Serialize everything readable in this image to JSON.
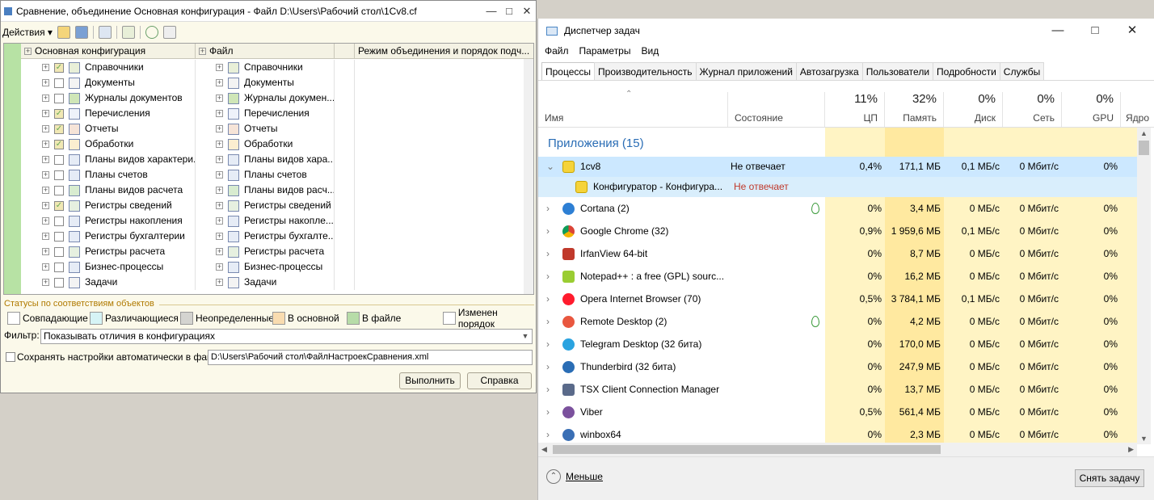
{
  "win1c": {
    "title": "Сравнение, объединение Основная конфигурация - Файл D:\\Users\\Рабочий стол\\1Cv8.cf",
    "actions": "Действия",
    "columns": [
      "Основная конфигурация",
      "Файл",
      "",
      "Режим объединения и порядок подч..."
    ],
    "rows": [
      {
        "left": "Справочники",
        "right": "Справочники",
        "checked": true
      },
      {
        "left": "Документы",
        "right": "Документы",
        "checked": false
      },
      {
        "left": "Журналы документов",
        "right": "Журналы докумен...",
        "checked": false
      },
      {
        "left": "Перечисления",
        "right": "Перечисления",
        "checked": true
      },
      {
        "left": "Отчеты",
        "right": "Отчеты",
        "checked": true
      },
      {
        "left": "Обработки",
        "right": "Обработки",
        "checked": true
      },
      {
        "left": "Планы видов характери...",
        "right": "Планы видов хара...",
        "checked": false
      },
      {
        "left": "Планы счетов",
        "right": "Планы счетов",
        "checked": false
      },
      {
        "left": "Планы видов расчета",
        "right": "Планы видов расч...",
        "checked": false
      },
      {
        "left": "Регистры сведений",
        "right": "Регистры сведений",
        "checked": true
      },
      {
        "left": "Регистры накопления",
        "right": "Регистры накопле...",
        "checked": false
      },
      {
        "left": "Регистры бухгалтерии",
        "right": "Регистры бухгалте...",
        "checked": false
      },
      {
        "left": "Регистры расчета",
        "right": "Регистры расчета",
        "checked": false
      },
      {
        "left": "Бизнес-процессы",
        "right": "Бизнес-процессы",
        "checked": false
      },
      {
        "left": "Задачи",
        "right": "Задачи",
        "checked": false
      }
    ],
    "legend_title": "Статусы по соответствиям объектов",
    "legend": [
      {
        "label": "Совпадающие",
        "color": "#ffffff"
      },
      {
        "label": "Различающиеся",
        "color": "#d6f4f6"
      },
      {
        "label": "Неопределенные",
        "color": "#d4d4d0"
      },
      {
        "label": "В основной",
        "color": "#f9dcb0"
      },
      {
        "label": "В файле",
        "color": "#b7dca8"
      },
      {
        "label": "Изменен порядок",
        "color": "#ffffff"
      }
    ],
    "filter_label": "Фильтр:",
    "filter_value": "Показывать отличия в конфигурациях",
    "save_label": "Сохранять настройки автоматически в файл:",
    "save_path": "D:\\Users\\Рабочий стол\\ФайлНастроекСравнения.xml",
    "btn_run": "Выполнить",
    "btn_help": "Справка"
  },
  "tm": {
    "title": "Диспетчер задач",
    "menu": [
      "Файл",
      "Параметры",
      "Вид"
    ],
    "tabs": [
      "Процессы",
      "Производительность",
      "Журнал приложений",
      "Автозагрузка",
      "Пользователи",
      "Подробности",
      "Службы"
    ],
    "headers": {
      "name": "Имя",
      "status": "Состояние",
      "cpu_pct": "11%",
      "cpu": "ЦП",
      "mem_pct": "32%",
      "mem": "Память",
      "disk_pct": "0%",
      "disk": "Диск",
      "net_pct": "0%",
      "net": "Сеть",
      "gpu_pct": "0%",
      "gpu": "GPU",
      "gpu_engine": "Ядро "
    },
    "group": "Приложения (15)",
    "processes": [
      {
        "name": "1cv8",
        "status": "Не отвечает",
        "cpu": "0,4%",
        "mem": "171,1 МБ",
        "disk": "0,1 МБ/с",
        "net": "0 Мбит/с",
        "gpu": "0%",
        "icon": "1c-icon",
        "expanded": true
      },
      {
        "name": "Конфигуратор - Конфигура...",
        "status": "Не отвечает",
        "child": true,
        "icon": "1c-icon"
      },
      {
        "name": "Cortana (2)",
        "status": "",
        "cpu": "0%",
        "mem": "3,4 МБ",
        "disk": "0 МБ/с",
        "net": "0 Мбит/с",
        "gpu": "0%",
        "icon": "cortana-icon",
        "leaf": true
      },
      {
        "name": "Google Chrome (32)",
        "status": "",
        "cpu": "0,9%",
        "mem": "1 959,6 МБ",
        "disk": "0,1 МБ/с",
        "net": "0 Мбит/с",
        "gpu": "0%",
        "icon": "chrome-icon"
      },
      {
        "name": "IrfanView 64-bit",
        "status": "",
        "cpu": "0%",
        "mem": "8,7 МБ",
        "disk": "0 МБ/с",
        "net": "0 Мбит/с",
        "gpu": "0%",
        "icon": "irfanview-icon"
      },
      {
        "name": "Notepad++ : a free (GPL) sourc...",
        "status": "",
        "cpu": "0%",
        "mem": "16,2 МБ",
        "disk": "0 МБ/с",
        "net": "0 Мбит/с",
        "gpu": "0%",
        "icon": "notepadpp-icon"
      },
      {
        "name": "Opera Internet Browser (70)",
        "status": "",
        "cpu": "0,5%",
        "mem": "3 784,1 МБ",
        "disk": "0,1 МБ/с",
        "net": "0 Мбит/с",
        "gpu": "0%",
        "icon": "opera-icon"
      },
      {
        "name": "Remote Desktop (2)",
        "status": "",
        "cpu": "0%",
        "mem": "4,2 МБ",
        "disk": "0 МБ/с",
        "net": "0 Мбит/с",
        "gpu": "0%",
        "icon": "remote-desktop-icon",
        "leaf": true
      },
      {
        "name": "Telegram Desktop (32 бита)",
        "status": "",
        "cpu": "0%",
        "mem": "170,0 МБ",
        "disk": "0 МБ/с",
        "net": "0 Мбит/с",
        "gpu": "0%",
        "icon": "telegram-icon"
      },
      {
        "name": "Thunderbird (32 бита)",
        "status": "",
        "cpu": "0%",
        "mem": "247,9 МБ",
        "disk": "0 МБ/с",
        "net": "0 Мбит/с",
        "gpu": "0%",
        "icon": "thunderbird-icon"
      },
      {
        "name": "TSX Client Connection Manager",
        "status": "",
        "cpu": "0%",
        "mem": "13,7 МБ",
        "disk": "0 МБ/с",
        "net": "0 Мбит/с",
        "gpu": "0%",
        "icon": "tsx-icon"
      },
      {
        "name": "Viber",
        "status": "",
        "cpu": "0,5%",
        "mem": "561,4 МБ",
        "disk": "0 МБ/с",
        "net": "0 Мбит/с",
        "gpu": "0%",
        "icon": "viber-icon"
      },
      {
        "name": "winbox64",
        "status": "",
        "cpu": "0%",
        "mem": "2,3 МБ",
        "disk": "0 МБ/с",
        "net": "0 Мбит/с",
        "gpu": "0%",
        "icon": "winbox-icon"
      }
    ],
    "less": "Меньше",
    "end_task": "Снять задачу",
    "colors": {
      "accent": "#2a6db5",
      "heat_light": "#fff4c4",
      "heat_mid": "#ffe9a0",
      "selected": "#cce8ff",
      "not_responding": "#c0392b"
    }
  }
}
